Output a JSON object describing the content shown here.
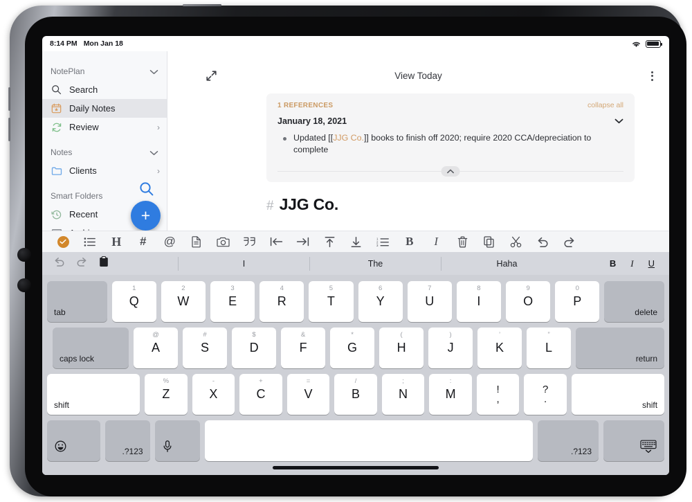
{
  "status_bar": {
    "time": "8:14 PM",
    "date": "Mon Jan 18",
    "wifi_icon": "wifi-icon",
    "battery_icon": "battery-icon"
  },
  "sidebar": {
    "sections": [
      {
        "label": "NotePlan",
        "chevron": "⌄",
        "strong": true
      },
      {
        "label": "Notes",
        "chevron": "⌄",
        "strong": true
      },
      {
        "label": "Smart Folders",
        "chevron": "",
        "strong": true
      }
    ],
    "noteplan_label": "NotePlan",
    "notes_label": "Notes",
    "smart_folders_label": "Smart Folders",
    "items": [
      {
        "label": "Search",
        "icon": "search-icon",
        "arrow": "",
        "selected": false
      },
      {
        "label": "Daily Notes",
        "icon": "calendar-star-icon",
        "arrow": "",
        "selected": true
      },
      {
        "label": "Review",
        "icon": "refresh-icon",
        "arrow": "›",
        "selected": false
      },
      {
        "label": "Clients",
        "icon": "folder-icon",
        "arrow": "›",
        "selected": false
      },
      {
        "label": "Recent",
        "icon": "clock-history-icon",
        "arrow": "",
        "selected": false
      },
      {
        "label": "Archive",
        "icon": "archive-icon",
        "arrow": "",
        "selected": false
      }
    ],
    "search_fab": "search-icon",
    "add_button": "+",
    "accent_color": "#2f7ce0"
  },
  "editor": {
    "nav_title": "View Today",
    "expand_icon": "expand-diagonal-icon",
    "more_icon": "more-vertical-icon",
    "scroll_chevron": "⌄",
    "references": {
      "count_label": "1 REFERENCES",
      "collapse_all_label": "collapse all",
      "date": "January 18, 2021",
      "date_chevron": "⌄",
      "collapse_chevron": "⌃",
      "accent_color": "#cb9a63",
      "bullet": {
        "prefix": "Updated [[",
        "link": "JJG Co.",
        "suffix": "]] books to finish off 2020; require 2020 CCA/depreciation to complete"
      }
    },
    "document": {
      "hash": "#",
      "title": "JJG Co."
    }
  },
  "md_toolbar": {
    "buttons": [
      {
        "name": "checkbox-task-icon",
        "glyph": "check"
      },
      {
        "name": "bullet-list-icon",
        "glyph": "list"
      },
      {
        "name": "heading-icon",
        "glyph": "H"
      },
      {
        "name": "tag-icon",
        "glyph": "#"
      },
      {
        "name": "mention-icon",
        "glyph": "@"
      },
      {
        "name": "note-link-icon",
        "glyph": "doc"
      },
      {
        "name": "camera-icon",
        "glyph": "camera"
      },
      {
        "name": "quote-icon",
        "glyph": "quote"
      },
      {
        "name": "outdent-icon",
        "glyph": "outdent"
      },
      {
        "name": "indent-icon",
        "glyph": "indent"
      },
      {
        "name": "move-up-icon",
        "glyph": "moveup"
      },
      {
        "name": "move-down-icon",
        "glyph": "movedown"
      },
      {
        "name": "numbered-list-icon",
        "glyph": "numlist"
      },
      {
        "name": "bold-icon",
        "glyph": "B"
      },
      {
        "name": "italic-icon",
        "glyph": "I"
      },
      {
        "name": "delete-icon",
        "glyph": "trash"
      },
      {
        "name": "copy-icon",
        "glyph": "copy"
      },
      {
        "name": "cut-icon",
        "glyph": "scissors"
      },
      {
        "name": "undo-icon",
        "glyph": "undo"
      },
      {
        "name": "redo-icon",
        "glyph": "redo"
      }
    ]
  },
  "predictive_bar": {
    "undo_icon": "undo-icon",
    "redo_icon": "redo-icon",
    "paste_icon": "paste-icon",
    "suggestions": [
      "I",
      "The",
      "Haha"
    ],
    "bold_label": "B",
    "italic_label": "I",
    "underline_label": "U"
  },
  "keyboard": {
    "rows": [
      [
        {
          "label": "tab",
          "type": "mod",
          "align": "left",
          "flex": 1.35
        },
        {
          "label": "Q",
          "sup": "1",
          "type": "key",
          "flex": 1
        },
        {
          "label": "W",
          "sup": "2",
          "type": "key",
          "flex": 1
        },
        {
          "label": "E",
          "sup": "3",
          "type": "key",
          "flex": 1
        },
        {
          "label": "R",
          "sup": "4",
          "type": "key",
          "flex": 1
        },
        {
          "label": "T",
          "sup": "5",
          "type": "key",
          "flex": 1
        },
        {
          "label": "Y",
          "sup": "6",
          "type": "key",
          "flex": 1
        },
        {
          "label": "U",
          "sup": "7",
          "type": "key",
          "flex": 1
        },
        {
          "label": "I",
          "sup": "8",
          "type": "key",
          "flex": 1
        },
        {
          "label": "O",
          "sup": "9",
          "type": "key",
          "flex": 1
        },
        {
          "label": "P",
          "sup": "0",
          "type": "key",
          "flex": 1
        },
        {
          "label": "delete",
          "type": "mod",
          "align": "right",
          "flex": 1.35
        }
      ],
      [
        {
          "label": "caps lock",
          "type": "mod",
          "align": "left",
          "flex": 1.72
        },
        {
          "label": "A",
          "sup": "@",
          "type": "key",
          "flex": 1
        },
        {
          "label": "S",
          "sup": "#",
          "type": "key",
          "flex": 1
        },
        {
          "label": "D",
          "sup": "$",
          "type": "key",
          "flex": 1
        },
        {
          "label": "F",
          "sup": "&",
          "type": "key",
          "flex": 1
        },
        {
          "label": "G",
          "sup": "*",
          "type": "key",
          "flex": 1
        },
        {
          "label": "H",
          "sup": "(",
          "type": "key",
          "flex": 1
        },
        {
          "label": "J",
          "sup": ")",
          "type": "key",
          "flex": 1
        },
        {
          "label": "K",
          "sup": "’",
          "type": "key",
          "flex": 1
        },
        {
          "label": "L",
          "sup": "”",
          "type": "key",
          "flex": 1
        },
        {
          "label": "return",
          "type": "mod",
          "align": "right",
          "flex": 2.0
        }
      ],
      [
        {
          "label": "shift",
          "type": "plain",
          "align": "left",
          "flex": 2.18
        },
        {
          "label": "Z",
          "sup": "%",
          "type": "key",
          "flex": 1
        },
        {
          "label": "X",
          "sup": "-",
          "type": "key",
          "flex": 1
        },
        {
          "label": "C",
          "sup": "+",
          "type": "key",
          "flex": 1
        },
        {
          "label": "V",
          "sup": "=",
          "type": "key",
          "flex": 1
        },
        {
          "label": "B",
          "sup": "/",
          "type": "key",
          "flex": 1
        },
        {
          "label": "N",
          "sup": ";",
          "type": "key",
          "flex": 1
        },
        {
          "label": "M",
          "sup": ":",
          "type": "key",
          "flex": 1
        },
        {
          "dual_top": "!",
          "dual_bot": ",",
          "type": "dual",
          "flex": 1
        },
        {
          "dual_top": "?",
          "dual_bot": ".",
          "type": "dual",
          "flex": 1
        },
        {
          "label": "shift",
          "type": "plain",
          "align": "right",
          "flex": 2.18
        }
      ],
      [
        {
          "label": "emoji-icon",
          "type": "mod-icon",
          "glyph": "emoji",
          "flex": 1.0
        },
        {
          "label": ".?123",
          "type": "mod-center",
          "flex": 0.85
        },
        {
          "label": "mic-icon",
          "type": "mod-icon",
          "glyph": "mic",
          "flex": 0.85
        },
        {
          "label": "",
          "type": "space",
          "flex": 6.2
        },
        {
          "label": ".?123",
          "type": "mod-center",
          "flex": 1.15
        },
        {
          "label": "hide-keyboard-icon",
          "type": "mod-icon",
          "glyph": "hidekb",
          "flex": 1.15
        }
      ]
    ],
    "home_indicator": "home-indicator"
  }
}
